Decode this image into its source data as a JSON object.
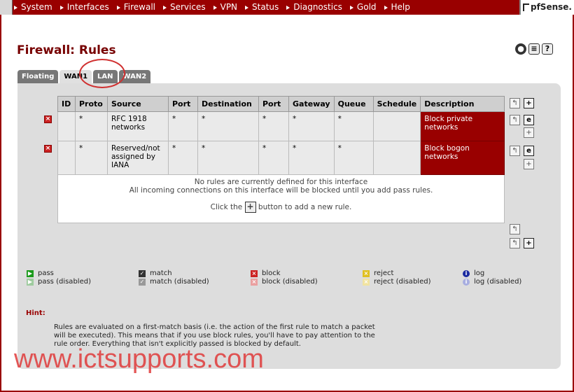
{
  "nav": {
    "items": [
      "System",
      "Interfaces",
      "Firewall",
      "Services",
      "VPN",
      "Status",
      "Diagnostics",
      "Gold",
      "Help"
    ],
    "logo": "pfSense."
  },
  "page": {
    "title": "Firewall: Rules"
  },
  "top_icons": [
    "status-icon",
    "list-icon",
    "help-icon"
  ],
  "tabs": [
    {
      "label": "Floating",
      "active": false
    },
    {
      "label": "WAN1",
      "active": true
    },
    {
      "label": "LAN",
      "active": false
    },
    {
      "label": "WAN2",
      "active": false
    }
  ],
  "table": {
    "headers": [
      "ID",
      "Proto",
      "Source",
      "Port",
      "Destination",
      "Port",
      "Gateway",
      "Queue",
      "Schedule",
      "Description"
    ],
    "rows": [
      {
        "id": "",
        "proto": "*",
        "source": "RFC 1918 networks",
        "port": "*",
        "destination": "*",
        "dport": "*",
        "gateway": "*",
        "queue": "*",
        "schedule": "",
        "description": "Block private networks"
      },
      {
        "id": "",
        "proto": "*",
        "source": "Reserved/not assigned by IANA",
        "port": "*",
        "destination": "*",
        "dport": "*",
        "gateway": "*",
        "queue": "*",
        "schedule": "",
        "description": "Block bogon networks"
      }
    ],
    "empty_line1": "No rules are currently defined for this interface",
    "empty_line2": "All incoming connections on this interface will be blocked until you add pass rules.",
    "click_before": "Click the",
    "click_after": "button to add a new rule."
  },
  "legend": [
    {
      "label": "pass",
      "icon": "pass-icon"
    },
    {
      "label": "pass (disabled)",
      "icon": "pass-disabled-icon"
    },
    {
      "label": "match",
      "icon": "match-icon"
    },
    {
      "label": "match (disabled)",
      "icon": "match-disabled-icon"
    },
    {
      "label": "block",
      "icon": "block-icon"
    },
    {
      "label": "block (disabled)",
      "icon": "block-disabled-icon"
    },
    {
      "label": "reject",
      "icon": "reject-icon"
    },
    {
      "label": "reject (disabled)",
      "icon": "reject-disabled-icon"
    },
    {
      "label": "log",
      "icon": "log-icon"
    },
    {
      "label": "log (disabled)",
      "icon": "log-disabled-icon"
    }
  ],
  "hint": {
    "title": "Hint:",
    "text": "Rules are evaluated on a first-match basis (i.e. the action of the first rule to match a packet will be executed). This means that if you use block rules, you'll have to pay attention to the rule order. Everything that isn't explicitly passed is blocked by default."
  },
  "watermark": "www.ictsupports.com",
  "colors": {
    "brand": "#990000",
    "panel": "#dddddd",
    "description_bg": "#990000"
  }
}
